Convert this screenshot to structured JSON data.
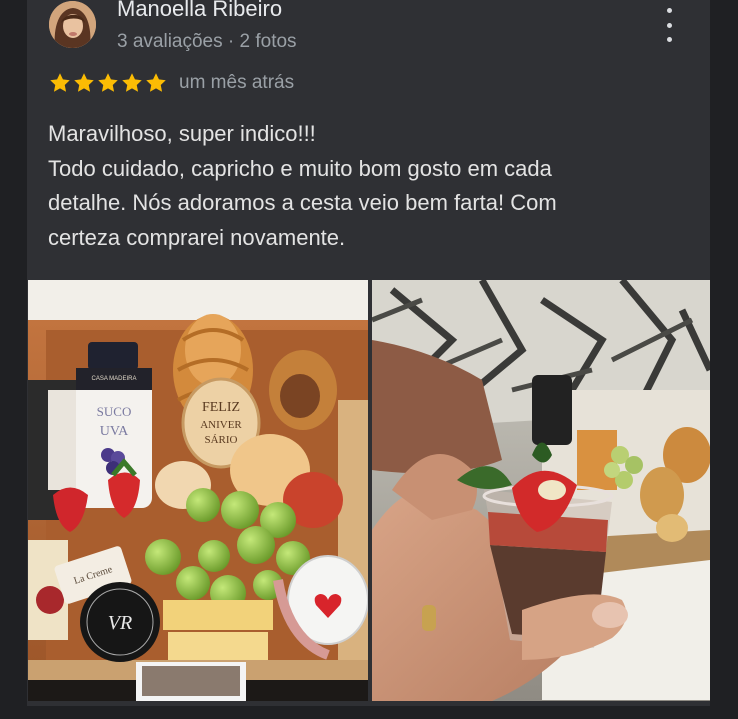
{
  "review": {
    "author_name": "Manoella Ribeiro",
    "author_meta": "3 avaliações · 2 fotos",
    "rating": 5,
    "rating_max": 5,
    "time": "um mês atrás",
    "text_lines": [
      "Maravilhoso, super indico!!!",
      "Todo cuidado, capricho e muito bom gosto em cada",
      "detalhe. Nós adoramos a cesta veio bem farta! Com",
      "certeza comprarei novamente."
    ]
  },
  "photo1": {
    "bottle_label_line1": "SUCO",
    "bottle_label_line2": "UVA",
    "bottle_brand": "CASA MADEIRA",
    "cookie_line1": "FELIZ",
    "cookie_line2": "ANIVER",
    "cookie_line3": "SÁRIO",
    "tag_text": "La Creme",
    "logo_text": "VR"
  },
  "colors": {
    "page_bg": "#1f2023",
    "card_bg": "#2f3034",
    "star": "#fbbc04",
    "primary_text": "#e8eaed",
    "secondary_text": "#9aa0a6"
  },
  "icons": {
    "more": "more-vert-icon",
    "star": "star-icon"
  }
}
